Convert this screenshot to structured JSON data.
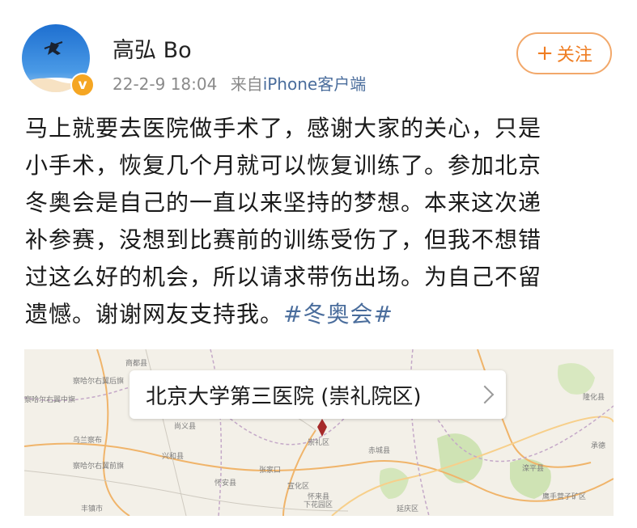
{
  "post": {
    "username": "高弘 Bo",
    "timestamp": "22-2-9 18:04",
    "source_prefix": "来自",
    "source": "iPhone客户端",
    "follow_label": "关注",
    "follow_icon": "plus-icon",
    "verified_icon": "v-badge-icon",
    "content_lines": [
      "马上就要去医院做手术了，感谢大家的关心，只是",
      "小手术，恢复几个月就可以恢复训练了。参加北京",
      "冬奥会是自己的一直以来坚持的梦想。本来这次递",
      "补参赛，没想到比赛前的训练受伤了，但我不想错",
      "过这么好的机会，所以请求带伤出场。为自己不留"
    ],
    "last_line_text": "遗憾。谢谢网友支持我。",
    "hashtag": "#冬奥会#"
  },
  "location": {
    "name": "北京大学第三医院 (崇礼院区)",
    "chevron_icon": "chevron-right-icon"
  },
  "map_labels": {
    "l1": "商都县",
    "l2": "察哈尔右翼后旗",
    "l3": "察哈尔右翼中旗",
    "l4": "乌兰察布",
    "l5": "察哈尔右翼前旗",
    "l6": "丰镇市",
    "l7": "尚义县",
    "l8": "兴和县",
    "l9": "张家口",
    "l10": "赤城县",
    "l11": "崇礼区",
    "l12": "怀安县",
    "l13": "宣化区",
    "l14": "下花园区",
    "l15": "延庆区",
    "l16": "滦平县",
    "l17": "承德",
    "l18": "隆化县",
    "l19": "鹰手营子矿区",
    "l20": "怀来县"
  },
  "colors": {
    "accent_orange": "#ef7d22",
    "link_blue": "#4a6d9c",
    "meta_gray": "#8a8a8a",
    "badge_gold": "#f5a623"
  }
}
